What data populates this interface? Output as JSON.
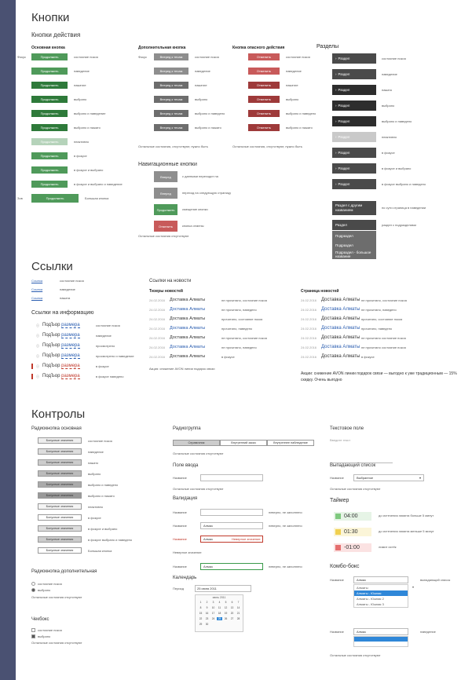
{
  "sections": {
    "buttons": "Кнопки",
    "links": "Ссылки",
    "controls": "Контролы"
  },
  "buttons": {
    "subtitle": "Кнопки действия",
    "col_main": "Основная кнопка",
    "col_extra": "Дополнительная кнопка",
    "col_danger": "Кнопка опасного действия",
    "col_sections": "Разделы",
    "main_label": "Продолжить",
    "extra_label": "Вперед к тесам",
    "danger_label": "Отменить",
    "states": [
      "состояние покоя",
      "наведение",
      "нажатие",
      "выбрано",
      "выбрано и наведение",
      "выбрано и нажато",
      "неактивно",
      "в фокусе",
      "в фокусе и выбрано",
      "в фокусе и выбрано и наведение"
    ],
    "danger_states": [
      "состояние покоя",
      "наведение",
      "нажатие",
      "выбрано",
      "выбрано и наведено",
      "выбрано и нажато"
    ],
    "extra_note": "Остальные состояния, отсутствуют, нужно быть",
    "danger_note": "Остальные состояния, отсутствуют, нужно быть",
    "nav_title": "Навигационные кнопки",
    "nav_states": [
      "с данными переходит на",
      "переход на следующую страницу",
      "смещение кнопки",
      "кнопка отмены"
    ],
    "nav_note": "Остальные состояния отсутствуют",
    "last_label": "Продолжить",
    "last_state": "Большая кнопка",
    "prefix_focus": "Фокус",
    "prefix_big": "Зов",
    "section_label": "Раздел",
    "section_states": [
      "состояние покоя",
      "наведение",
      "нажато",
      "выбрано",
      "выбрано и наведено",
      "неактивно",
      "в фокусе",
      "в фокусе и выбрано",
      "в фокусе выбрано и наведено"
    ],
    "section_group_label": "Раздел с другим названием",
    "section_group_state": "по сути страница в наведении",
    "section_menu_label": "Раздел",
    "section_menu_state": "раздел с подразделами",
    "section_menu_items": [
      "Подраздел",
      "Подраздел",
      "Подраздел - большое название"
    ]
  },
  "links": {
    "rows": [
      {
        "link": "Ссылка",
        "state": "состояние покоя"
      },
      {
        "link": "Ссылка",
        "state": "наведение"
      },
      {
        "link": "Ссылка",
        "state": "нажата"
      }
    ],
    "info_title": "Ссылки на информацию",
    "info_rows": [
      {
        "a": "ПодЪор",
        "b": "размера",
        "state": "состояние покоя"
      },
      {
        "a": "ПодЪор",
        "b": "размера",
        "state": "наведение"
      },
      {
        "a": "ПодЪор",
        "b": "размера",
        "state": "просмотрено"
      },
      {
        "a": "ПодЪор",
        "b": "размера",
        "state": "просмотрено и наведение"
      },
      {
        "a": "ПодЪор",
        "b": "размера",
        "state": "в фокусе"
      },
      {
        "a": "ПодЪор",
        "b": "размера",
        "state": "в фокусе наведено"
      }
    ],
    "news_title": "Ссылки на новости",
    "news_col1": "Тизеры новостей",
    "news_col2": "Страница новостей",
    "news_link": "Доставка Алматы",
    "news_date": "24.02.2016",
    "news_states": [
      "не прочитано, состояние покоя",
      "не прочитано, наведено",
      "прочитано, состояние покоя",
      "прочитано, наведено",
      "не прочитано, состояние покоя",
      "не прочитано, наведено",
      "в фокусе"
    ],
    "news_states2": [
      "не прочитано, состояние покоя",
      "не прочитано, наведено",
      "прочитано, состояние покоя",
      "прочитано, наведено",
      "не прочитано состояние покоя",
      "не прочитано состояние покоя",
      "в фокусе"
    ],
    "news_long": "Акция: снижение AVON линии подарок связи",
    "news_long2": "Акции: снижение AVON линии подарок связи — выгодно к уже традиционным — 15% скидку. Очень выгодно"
  },
  "controls": {
    "radio_title": "Радиокнопка основная",
    "radio_label": "Бонусные значения",
    "radio_states": [
      "состояние покоя",
      "наведение",
      "нажато",
      "выбрано",
      "выбрано и наведено",
      "выбрано и нажато",
      "неактивно",
      "в фокусе",
      "в фокусе и выбрано",
      "в фокусе выбрано и наведено",
      "Большая кнопка"
    ],
    "radio_extra_title": "Радиокнопка дополнительная",
    "radio_extra_items": [
      "состояние покоя",
      "выбрано"
    ],
    "radio_extra_note": "Остальные состояния отсутствуют",
    "checkbox_title": "Чекбокс",
    "checkbox_items": [
      "состояние покоя",
      "выбрано"
    ],
    "checkbox_note": "Остальные состояния отсутствуют",
    "radiogroup_title": "Радиогруппа",
    "radiogroup_items": [
      "Справочник",
      "Внутренний заказ",
      "Внутреннее наблюдение"
    ],
    "radiogroup_note": "Остальные состояния отсутствуют",
    "input_title": "Поле ввода",
    "input_label": "Название",
    "input_note": "Остальные состояния отсутствуют",
    "validation_title": "Валидация",
    "validation_rows": [
      {
        "label": "Название",
        "value": "",
        "state": "неверно, не заполнено"
      },
      {
        "label": "Название",
        "value": "Алмаз",
        "state": "неверно, не заполнено"
      },
      {
        "label": "Название",
        "value": "Алмаз",
        "state": "Неверное значение"
      },
      {
        "label": "Название",
        "value": "Алмаз",
        "state": "неверно, не заполнено"
      }
    ],
    "validation_note": "Неверное значение",
    "calendar_title": "Календарь",
    "calendar_label": "Период",
    "calendar_value": "25 июня 2011",
    "calendar_month": "июнь 2011",
    "textfield_title": "Текстовое поле",
    "textfield_placeholder": "Введите текст",
    "dropdown_title": "Выпадающий список",
    "dropdown_label": "Название",
    "dropdown_value": "Выбранное",
    "dropdown_note": "Остальные состояния отсутствуют",
    "timer_title": "Таймер",
    "timers": [
      {
        "value": "04:00",
        "color": "#7fc97f",
        "bg": "#e6f4e6",
        "state": "до истечения лимита больше 5 минут"
      },
      {
        "value": "01:30",
        "color": "#f0d050",
        "bg": "#fbf5d8",
        "state": "до истечения лимита меньше 5 минут"
      },
      {
        "value": "-01:00",
        "color": "#e56f6f",
        "bg": "#fbe2e2",
        "state": "лимит истёк"
      }
    ],
    "combo_title": "Комбо-бокс",
    "combo_label": "Название",
    "combo_value": "Алмаз",
    "combo_items": [
      "Алматы",
      "Алматы - Южная",
      "Алматы - Южная 2",
      "Алматы - Южная 3"
    ],
    "combo_state": "выпадающий список",
    "combo2_value": "Алмаз",
    "combo2_state": "наведение",
    "combo_note": "Остальные состояния отсутствуют"
  }
}
